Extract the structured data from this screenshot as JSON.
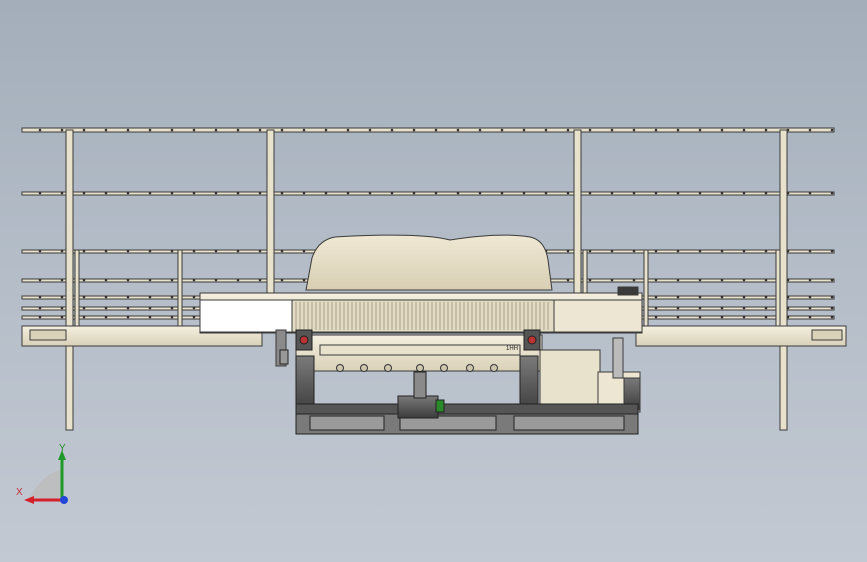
{
  "viewport": {
    "background_top": "#a3aeba",
    "background_bottom": "#c3c9d3"
  },
  "model": {
    "part_color": "#ece6d2",
    "edge_color": "#3a3a3a",
    "frame_color": "#555555",
    "dark_color": "#3d3d3d",
    "plate_label": "1HH"
  },
  "triad": {
    "x_label": "X",
    "y_label": "Y",
    "x_color": "#d3202a",
    "y_color": "#1f9a2a",
    "z_color": "#2246d6"
  }
}
